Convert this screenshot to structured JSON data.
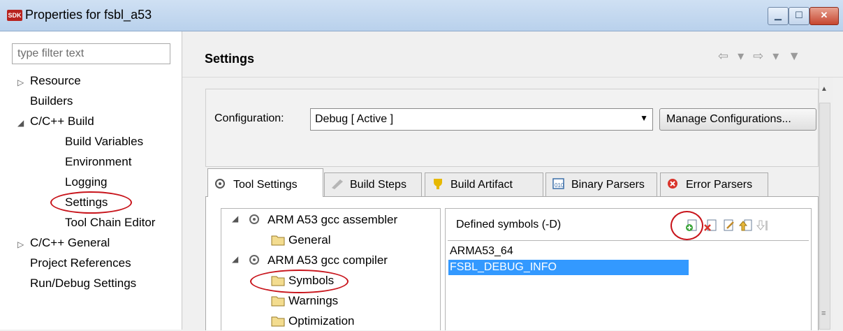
{
  "window": {
    "title": "Properties for fsbl_a53",
    "app_icon": "SDK",
    "controls": {
      "minimize": "▁",
      "maximize": "☐",
      "close": "✕"
    }
  },
  "filter": {
    "placeholder": "type filter text"
  },
  "nav": {
    "items": [
      {
        "label": "Resource"
      },
      {
        "label": "Builders"
      },
      {
        "label": "C/C++ Build"
      },
      {
        "label": "Build Variables"
      },
      {
        "label": "Environment"
      },
      {
        "label": "Logging"
      },
      {
        "label": "Settings"
      },
      {
        "label": "Tool Chain Editor"
      },
      {
        "label": "C/C++ General"
      },
      {
        "label": "Project References"
      },
      {
        "label": "Run/Debug Settings"
      }
    ],
    "twisty_collapsed": "▷",
    "twisty_expanded": "◢"
  },
  "page": {
    "title": "Settings",
    "nav_arrows": "⇦ ▾ ⇨ ▾ ▼"
  },
  "configuration": {
    "label": "Configuration:",
    "value": "Debug  [ Active ]",
    "manage_label": "Manage Configurations..."
  },
  "tabs": [
    {
      "label": "Tool Settings"
    },
    {
      "label": "Build Steps"
    },
    {
      "label": "Build Artifact"
    },
    {
      "label": "Binary Parsers"
    },
    {
      "label": "Error Parsers"
    }
  ],
  "tool_tree": {
    "items": [
      {
        "label": "ARM A53 gcc assembler"
      },
      {
        "label": "General"
      },
      {
        "label": "ARM A53 gcc compiler"
      },
      {
        "label": "Symbols"
      },
      {
        "label": "Warnings"
      },
      {
        "label": "Optimization"
      }
    ]
  },
  "symbols": {
    "header": "Defined symbols (-D)",
    "rows": [
      {
        "value": "ARMA53_64"
      },
      {
        "value": "FSBL_DEBUG_INFO"
      }
    ],
    "selected_index": 1
  },
  "colors": {
    "highlight": "#3399ff",
    "annotation_ring": "#c8141b"
  }
}
